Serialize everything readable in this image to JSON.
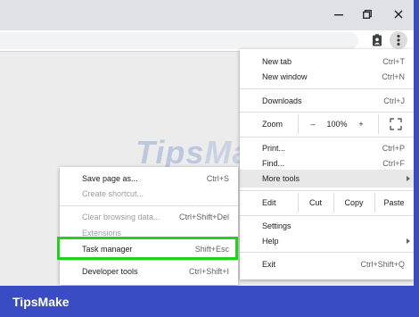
{
  "window": {
    "minimize": "—",
    "restore": "⧉",
    "close": "✕"
  },
  "icons": {
    "extension": "clipboard-person-icon",
    "menu": "kebab-menu-icon"
  },
  "watermark": {
    "part1": "Tips",
    "part2": "Make"
  },
  "main_menu": {
    "new_tab": {
      "label": "New tab",
      "shortcut": "Ctrl+T"
    },
    "new_window": {
      "label": "New window",
      "shortcut": "Ctrl+N"
    },
    "downloads": {
      "label": "Downloads",
      "shortcut": "Ctrl+J"
    },
    "zoom": {
      "label": "Zoom",
      "minus": "–",
      "value": "100%",
      "plus": "+"
    },
    "print": {
      "label": "Print...",
      "shortcut": "Ctrl+P"
    },
    "find": {
      "label": "Find...",
      "shortcut": "Ctrl+F"
    },
    "more_tools": {
      "label": "More tools"
    },
    "edit": {
      "label": "Edit",
      "cut": "Cut",
      "copy": "Copy",
      "paste": "Paste"
    },
    "settings": {
      "label": "Settings"
    },
    "help": {
      "label": "Help"
    },
    "exit": {
      "label": "Exit",
      "shortcut": "Ctrl+Shift+Q"
    }
  },
  "submenu": {
    "save_page": {
      "label": "Save page as...",
      "shortcut": "Ctrl+S"
    },
    "create_shortcut": {
      "label": "Create shortcut..."
    },
    "clear_browsing": {
      "label": "Clear browsing data...",
      "shortcut": "Ctrl+Shift+Del"
    },
    "extensions": {
      "label": "Extensions"
    },
    "task_manager": {
      "label": "Task manager",
      "shortcut": "Shift+Esc"
    },
    "developer_tools": {
      "label": "Developer tools",
      "shortcut": "Ctrl+Shift+I"
    }
  },
  "brand": "TipsMake",
  "colors": {
    "frame": "#3a4cc4",
    "highlight": "#22d11e"
  }
}
